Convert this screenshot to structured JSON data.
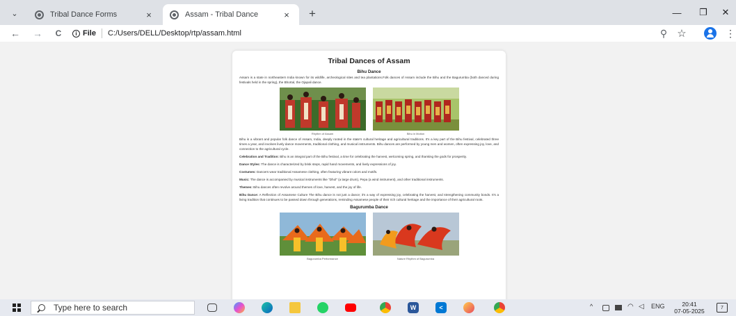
{
  "browser": {
    "tab_menu_icon": "chevron-down-icon",
    "tabs": [
      {
        "title": "Tribal Dance Forms",
        "favicon": "globe-icon",
        "close": "×",
        "active": false
      },
      {
        "title": "Assam - Tribal Dance",
        "favicon": "globe-icon",
        "close": "×",
        "active": true
      }
    ],
    "new_tab": "+",
    "window_controls": {
      "minimize": "—",
      "restore": "❐",
      "close": "✕"
    },
    "nav": {
      "back": "←",
      "forward": "→",
      "reload": "C"
    },
    "address": {
      "badge_icon": "i",
      "badge_label": "File",
      "url": "C:/Users/DELL/Desktop/rtp/assam.html"
    },
    "actions": {
      "zoom": "⚲",
      "bookmark": "☆",
      "menu": "⋮"
    }
  },
  "page": {
    "title": "Tribal Dances of Assam",
    "bihu_heading": "Bihu Dance",
    "intro": "Assam is a state in northeastern India known for its wildlife, archeological sites and tea plantations.Folk dances of Assam include the Bihu and the Bagurumba (both danced during festivals held in the spring), the Bhortal, the Ojapali dance.",
    "gallery1": [
      {
        "caption": "Rhythm of Assam"
      },
      {
        "caption": "Bihu in Motion"
      }
    ],
    "paragraphs": [
      {
        "label": "",
        "text": "Bihu is a vibrant and popular folk dance of Assam, India, deeply rooted in the state's cultural heritage and agricultural traditions. It's a key part of the Bihu festival, celebrated three times a year, and involves lively dance movements, traditional clothing, and musical instruments. Bihu dances are performed by young men and women, often expressing joy, love, and connection to the agricultural cycle."
      },
      {
        "label": "Celebration and Tradition:",
        "text": " Bihu is an integral part of the Bihu festival, a time for celebrating the harvest, welcoming spring, and thanking the gods for prosperity."
      },
      {
        "label": "Dance Styles:",
        "text": " The dance is characterized by brisk steps, rapid hand movements, and lively expressions of joy."
      },
      {
        "label": "Costumes:",
        "text": " Dancers wear traditional Assamese clothing, often featuring vibrant colors and motifs."
      },
      {
        "label": "Music:",
        "text": " The dance is accompanied by musical instruments like \"Dhol\" (a large drum), Pepa (a wind instrument), and other traditional instruments."
      },
      {
        "label": "Themes:",
        "text": " Bihu dances often revolve around themes of love, harvest, and the joy of life."
      },
      {
        "label": "Bihu Dance:",
        "text": " A Reflection of Assamese Culture The Bihu dance is not just a dance; it's a way of expressing joy, celebrating the harvest, and strengthening community bonds. It's a living tradition that continues to be passed down through generations, reminding Assamese people of their rich cultural heritage and the importance of their agricultural roots."
      }
    ],
    "bagurumba_heading": "Bagurumba Dance",
    "gallery2": [
      {
        "caption": "Bagurumba Performance"
      },
      {
        "caption": "Nature Rhythm of Bagurumba"
      }
    ]
  },
  "taskbar": {
    "start_icon": "windows-logo-icon",
    "search_placeholder": "Type here to search",
    "apps": [
      "task-view-icon",
      "copilot-icon",
      "edge-icon",
      "file-explorer-icon",
      "whatsapp-icon",
      "youtube-icon",
      "chrome-icon",
      "word-icon",
      "vscode-icon",
      "paint-icon",
      "chrome-icon"
    ],
    "tray": {
      "chevron": "^",
      "lang": "ENG"
    },
    "clock": {
      "time": "20:41",
      "date": "07-05-2025"
    },
    "notifications": "7"
  }
}
